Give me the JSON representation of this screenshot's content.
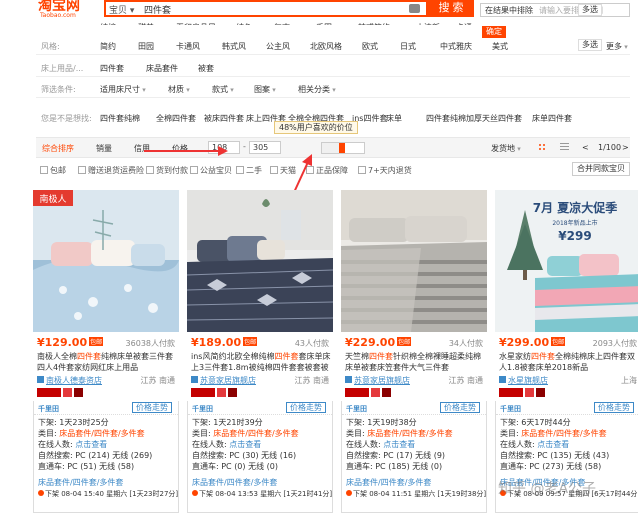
{
  "header": {
    "logo": "淘宝网",
    "logo_sub": "Taobao.com",
    "search_scope": "宝贝 ▾",
    "search_query": "四件套",
    "search_button": "搜 索",
    "result_filter_label": "在结果中排除",
    "result_filter_placeholder": "请输入要排除的词"
  },
  "top_partial_row": [
    "纯棉",
    "甜美",
    "无印良品风",
    "纯色",
    "复古",
    "禾田",
    "韩式简约",
    "小清新",
    "卡通"
  ],
  "filters": {
    "style": {
      "label": "风格:",
      "options": [
        "简约",
        "田园",
        "卡通风",
        "韩式风",
        "公主风",
        "北欧风格",
        "欧式",
        "日式",
        "中式雅庆",
        "美式"
      ],
      "multi": "多选",
      "more": "更多"
    },
    "bedding": {
      "label": "床上用品/...",
      "options": [
        "四件套",
        "床品套件",
        "被套"
      ]
    },
    "conditions": {
      "label": "筛选条件:",
      "options": [
        "适用床尺寸",
        "材质",
        "款式",
        "图案",
        "相关分类"
      ]
    },
    "suggest": {
      "label": "您是不是想找:",
      "options": [
        "四件套纯棉",
        "全棉四件套",
        "被床四件套",
        "床上四件套",
        "全棉全棉四件套",
        "ins四件套",
        "床单",
        "四件套纯棉加厚",
        "天丝四件套",
        "床单四件套"
      ]
    },
    "confirm": "确定",
    "multi": "多选",
    "more": "更多"
  },
  "sort_bar": {
    "items": [
      "综合排序",
      "销量",
      "信用",
      "价格"
    ],
    "price_min": "108",
    "price_sep": "-",
    "price_max": "305",
    "slider_position_pct": 48,
    "tooltip": "48%用户喜欢的价位",
    "ship_from": "发货地",
    "pager": "1/100",
    "prev": "<",
    "next": ">"
  },
  "checkboxes": [
    "包邮",
    "赠送退货运费险",
    "货到付款",
    "公益宝贝",
    "二手",
    "天猫",
    "正品保障",
    "7+天内退货"
  ],
  "merge_button": "合并同款宝贝",
  "products": [
    {
      "price": "¥129.00",
      "post": "包邮",
      "sales": "36038人付款",
      "title_parts": [
        "南极人全棉",
        "四件套",
        "纯棉床单被套三件套四人4件套家纺网红床上用品"
      ],
      "shop": "南极人德泰资店",
      "location": "江苏 南通",
      "quick_line": "下架: 1天23时25分",
      "category_line_label": "类目: ",
      "category_line_value": "床品套件/四件套/多件套",
      "online_label": "在线人数: ",
      "online_value": "点击查看",
      "natural_line": "自然搜索: PC (214) 无线 (269)",
      "direct_line": "直通车: PC (51) 无线 (58)",
      "cat2": "床品套件/四件套/多件套",
      "footer": "下架 08-04 15:40 星期六 [1天23时27分]"
    },
    {
      "price": "¥189.00",
      "post": "包邮",
      "sales": "43人付款",
      "title_parts": [
        "ins风简约北欧全棉纯棉",
        "四件套",
        "套床单床上3三件套1.8m被纯棉四件套套被套被单"
      ],
      "shop": "苏意家居旗舰店",
      "location": "江苏 南通",
      "quick_line": "下架: 1天21时39分",
      "category_line_label": "类目: ",
      "category_line_value": "床品套件/四件套/多件套",
      "online_label": "在线人数: ",
      "online_value": "点击查看",
      "natural_line": "自然搜索: PC (30) 无线 (16)",
      "direct_line": "直通车: PC (0) 无线 (0)",
      "cat2": "床品套件/四件套/多件套",
      "footer": "下架 08-04 13:53 星期六 [1天21时41分]"
    },
    {
      "price": "¥229.00",
      "post": "包邮",
      "sales": "34人付款",
      "title_parts": [
        "天竺棉",
        "四件套",
        "针织棉全棉裸睡超柔纯棉床单被套床笠套件大气三件套"
      ],
      "shop": "苏意家居旗舰店",
      "location": "江苏 南通",
      "quick_line": "下架: 1天19时38分",
      "category_line_label": "类目: ",
      "category_line_value": "床品套件/四件套/多件套",
      "online_label": "在线人数: ",
      "online_value": "点击查看",
      "natural_line": "自然搜索: PC (17) 无线 (9)",
      "direct_line": "直通车: PC (185) 无线 (0)",
      "cat2": "床品套件/四件套/多件套",
      "footer": "下架 08-04 11:51 星期六 [1天19时38分]"
    },
    {
      "price": "¥299.00",
      "post": "包邮",
      "sales": "2093人付款",
      "title_parts": [
        "水星家纺",
        "四件套",
        "全棉纯棉床上四件套双人1.8被套床单2018新品"
      ],
      "shop": "水星旗舰店",
      "location": "上海",
      "quick_line": "下架: 6天17时44分",
      "category_line_label": "类目: ",
      "category_line_value": "床品套件/四件套/多件套",
      "online_label": "在线人数: ",
      "online_value": "点击查看",
      "natural_line": "自然搜索: PC (135) 无线 (43)",
      "direct_line": "直通车: PC (273) 无线 (58)",
      "cat2": "床品套件/四件套/多件套",
      "footer": "下架 08-09 09:57 星期四 [6天17时44分]"
    }
  ],
  "image_text": {
    "card1_logo": "南极人",
    "card4_banner": "7月 夏凉大促季",
    "card4_sub": "2018年新品上市",
    "card4_price": "¥299"
  },
  "labels": {
    "qianniu": "千里田",
    "price_trend": "价格走势"
  },
  "watermark": "知乎 @老A公子"
}
